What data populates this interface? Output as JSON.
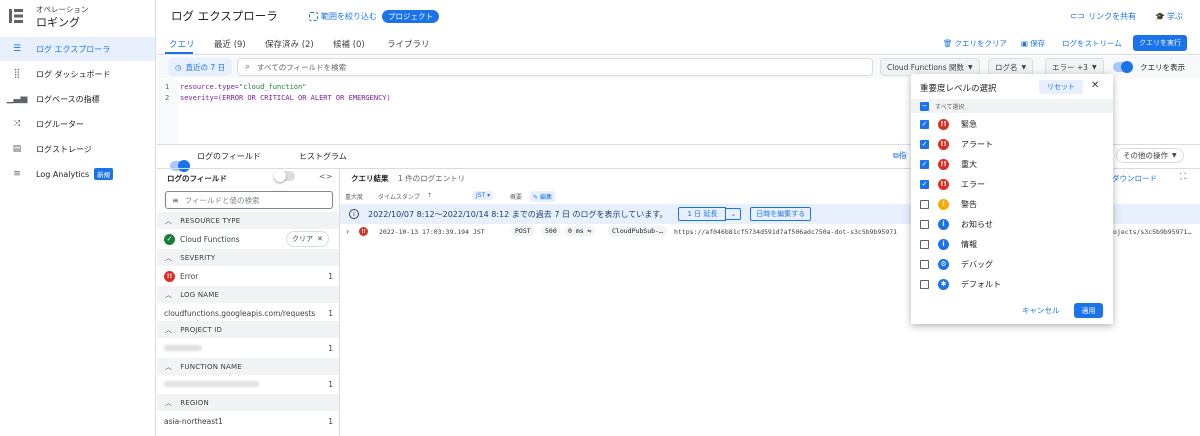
{
  "nav": {
    "subtitle": "オペレーション",
    "title": "ロギング",
    "items": [
      {
        "label": "ログ エクスプローラ",
        "icon": "list-icon"
      },
      {
        "label": "ログ ダッシュボード",
        "icon": "dashboard-icon"
      },
      {
        "label": "ログベースの指標",
        "icon": "bar-chart-icon"
      },
      {
        "label": "ログルーター",
        "icon": "shuffle-icon"
      },
      {
        "label": "ログストレージ",
        "icon": "storage-icon"
      },
      {
        "label": "Log Analytics",
        "icon": "search-list-icon",
        "badge": "新規"
      }
    ]
  },
  "header": {
    "title": "ログ エクスプローラ",
    "scope_label": "範囲を絞り込む",
    "scope_badge": "プロジェクト",
    "share_label": "リンクを共有",
    "learn_label": "学ぶ"
  },
  "tabs": {
    "query": "クエリ",
    "recent": "最近 (9)",
    "saved": "保存済み (2)",
    "suggested": "候補 (0)",
    "library": "ライブラリ",
    "clear_query": "クエリをクリア",
    "save": "保存",
    "stream": "ログをストリーム",
    "run": "クエリを実行"
  },
  "toolbar": {
    "time_range": "直近の 7 日",
    "search_placeholder": "すべてのフィールドを検索",
    "resource_chip": "Cloud Functions 関数",
    "log_name_chip": "ログ名",
    "severity_chip": "エラー +3",
    "show_query": "クエリを表示"
  },
  "editor": {
    "lines": [
      {
        "num": "1",
        "key": "resource.type=",
        "val": "\"cloud_function\""
      },
      {
        "num": "2",
        "key": "severity=(ERROR OR CRITICAL OR ALERT OR EMERGENCY)",
        "val": ""
      }
    ]
  },
  "controls": {
    "log_fields": "ログのフィールド",
    "histogram": "ヒストグラム",
    "other_ops": "その他の操作",
    "download": "ダウンロード"
  },
  "fields_panel": {
    "title": "ログのフィールド",
    "filter_placeholder": "フィールドと値の検索",
    "sections": [
      {
        "name": "RESOURCE TYPE",
        "value": "Cloud Functions",
        "count": "",
        "action": "クリア"
      },
      {
        "name": "SEVERITY",
        "value": "Error",
        "count": "1"
      },
      {
        "name": "LOG NAME",
        "value": "cloudfunctions.googleapis.com/requests",
        "count": "1"
      },
      {
        "name": "PROJECT ID",
        "value": "",
        "count": "1"
      },
      {
        "name": "FUNCTION NAME",
        "value": "",
        "count": "1"
      },
      {
        "name": "REGION",
        "value": "asia-northeast1",
        "count": "1"
      }
    ]
  },
  "results": {
    "title": "クエリ結果",
    "count": "1 件のログエントリ",
    "col_severity": "重大度",
    "col_timestamp": "タイムスタンプ",
    "tz": "JST",
    "col_summary": "概要",
    "edit": "編集",
    "info_text": "2022/10/07 8:12～2022/10/14 8:12 までの過去 7 日 のログを表示しています。",
    "extend": "1 日 延長",
    "edit_time": "日時を編集する",
    "entry": {
      "timestamp": "2022-10-13 17:03:39.194 JST",
      "method": "POST",
      "status": "500",
      "latency": "0 ms",
      "agent": "CloudPubSub-…",
      "url": "https://af046b81cf5734d591d7af506adc750a-dot-s3c5b9b95971",
      "url_tail": "ojects/s3c5b9b95971…"
    }
  },
  "severity_popup": {
    "title": "重要度レベルの選択",
    "reset": "リセット",
    "select_all": "すべて選択",
    "levels": [
      {
        "label": "緊急",
        "checked": true,
        "color": "#d93025",
        "icon": "!!"
      },
      {
        "label": "アラート",
        "checked": true,
        "color": "#d93025",
        "icon": "!!"
      },
      {
        "label": "重大",
        "checked": true,
        "color": "#d93025",
        "icon": "!!"
      },
      {
        "label": "エラー",
        "checked": true,
        "color": "#d93025",
        "icon": "!!"
      },
      {
        "label": "警告",
        "checked": false,
        "color": "#f9ab00",
        "icon": "!"
      },
      {
        "label": "お知らせ",
        "checked": false,
        "color": "#1a73e8",
        "icon": "i"
      },
      {
        "label": "情報",
        "checked": false,
        "color": "#1a73e8",
        "icon": "i"
      },
      {
        "label": "デバッグ",
        "checked": false,
        "color": "#1a73e8",
        "icon": "⚙"
      },
      {
        "label": "デフォルト",
        "checked": false,
        "color": "#1a73e8",
        "icon": "✱"
      }
    ],
    "cancel": "キャンセル",
    "apply": "適用"
  }
}
